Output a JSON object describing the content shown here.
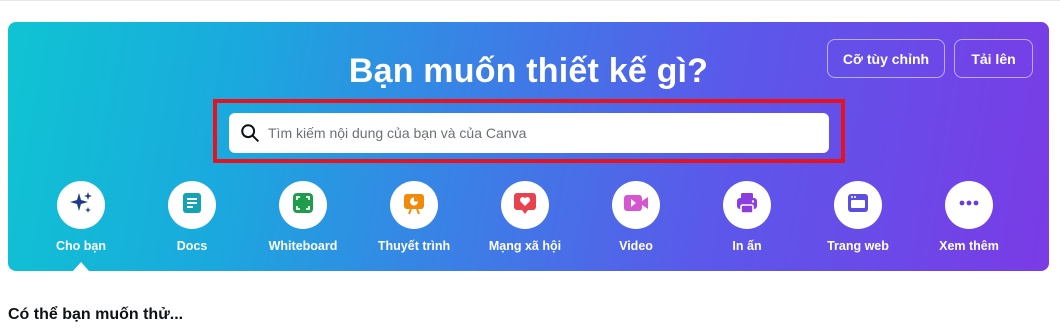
{
  "hero": {
    "title": "Bạn muốn thiết kế gì?",
    "buttons": {
      "custom": "Cỡ tùy chỉnh",
      "upload": "Tải lên"
    }
  },
  "search": {
    "placeholder": "Tìm kiếm nội dung của bạn và của Canva",
    "value": ""
  },
  "categories": [
    {
      "label": "Cho bạn",
      "icon": "sparkle-icon",
      "color": "#1e3a8a",
      "active": true
    },
    {
      "label": "Docs",
      "icon": "doc-icon",
      "color": "#13a3b5"
    },
    {
      "label": "Whiteboard",
      "icon": "whiteboard-icon",
      "color": "#1f9d4c"
    },
    {
      "label": "Thuyết trình",
      "icon": "presentation-icon",
      "color": "#f08a08"
    },
    {
      "label": "Mạng xã hội",
      "icon": "heart-chat-icon",
      "color": "#e8424f"
    },
    {
      "label": "Video",
      "icon": "video-camera-icon",
      "color": "#d656cf"
    },
    {
      "label": "In ấn",
      "icon": "printer-icon",
      "color": "#8a3ee0"
    },
    {
      "label": "Trang web",
      "icon": "browser-icon",
      "color": "#5a4fe0"
    },
    {
      "label": "Xem thêm",
      "icon": "more-dots-icon",
      "color": "#6a3be0"
    }
  ],
  "section": {
    "title": "Có thể bạn muốn thử..."
  }
}
